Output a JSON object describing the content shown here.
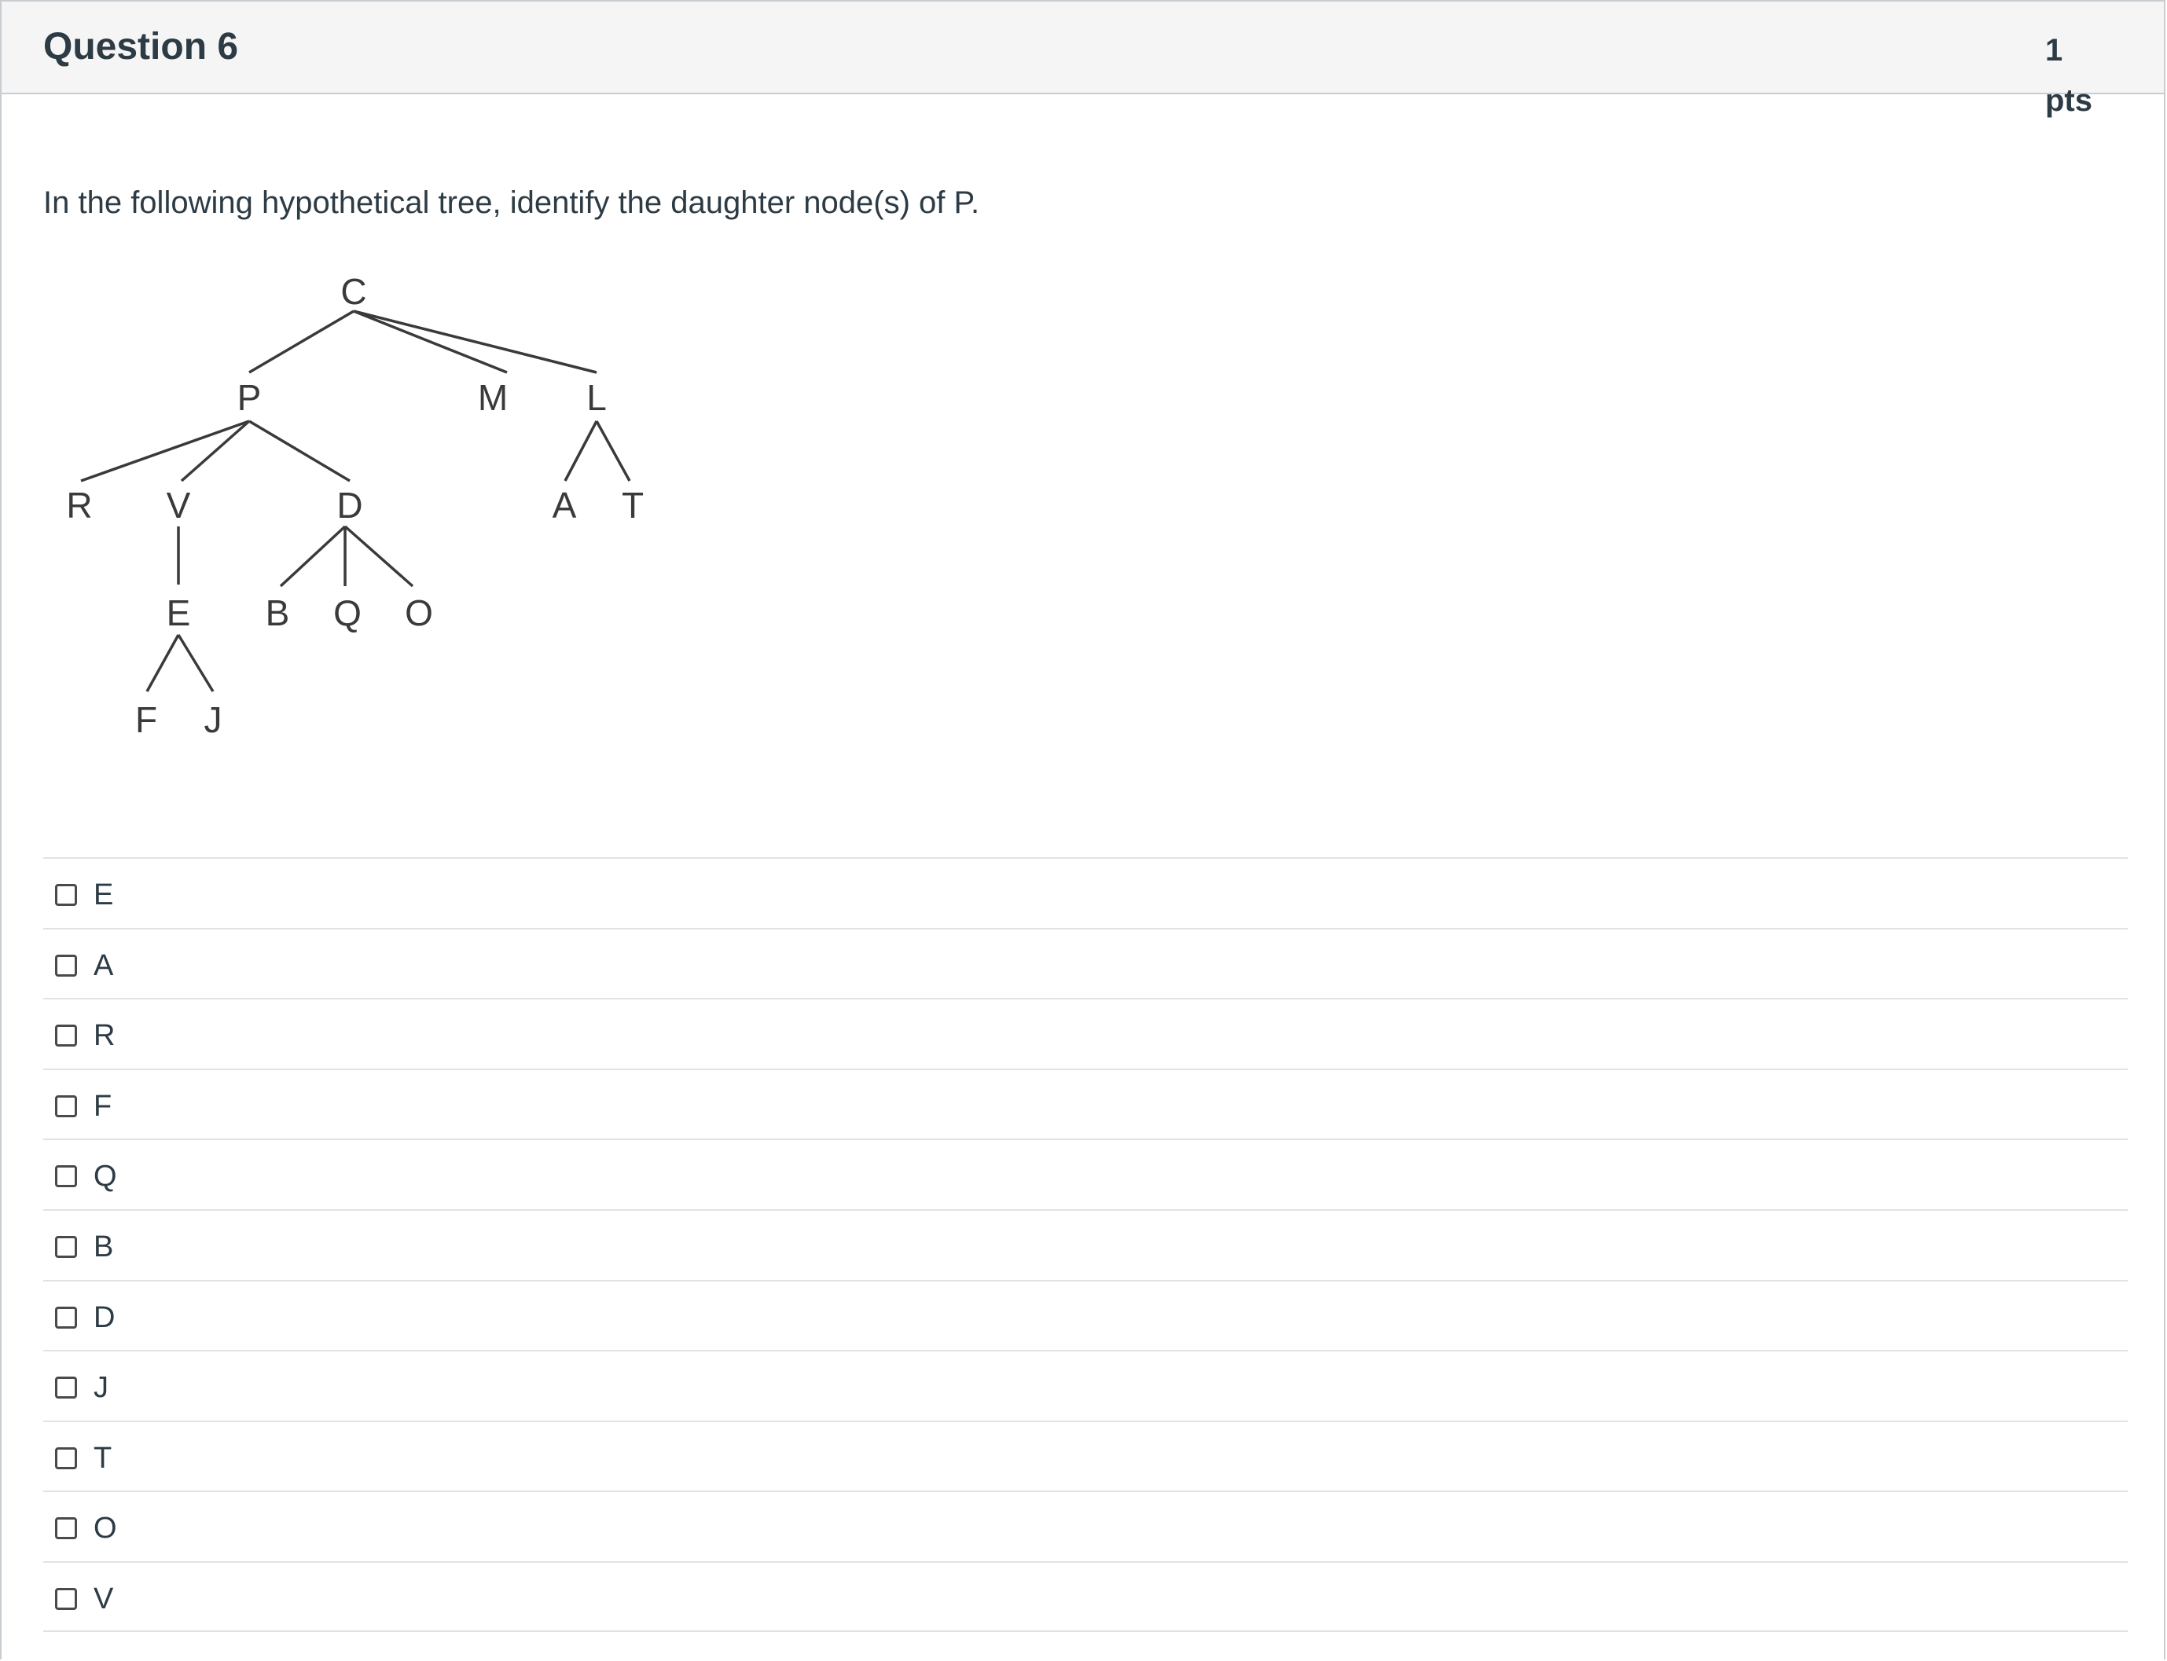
{
  "question": {
    "title": "Question 6",
    "points": "1 pts",
    "prompt": "In the following hypothetical tree, identify the daughter node(s) of P."
  },
  "tree": {
    "nodes": [
      "C",
      "P",
      "M",
      "L",
      "R",
      "V",
      "D",
      "A",
      "T",
      "E",
      "B",
      "Q",
      "O",
      "F",
      "J"
    ]
  },
  "answers": [
    {
      "label": "E",
      "checked": false
    },
    {
      "label": "A",
      "checked": false
    },
    {
      "label": "R",
      "checked": false
    },
    {
      "label": "F",
      "checked": false
    },
    {
      "label": "Q",
      "checked": false
    },
    {
      "label": "B",
      "checked": false
    },
    {
      "label": "D",
      "checked": false
    },
    {
      "label": "J",
      "checked": false
    },
    {
      "label": "T",
      "checked": false
    },
    {
      "label": "O",
      "checked": false
    },
    {
      "label": "V",
      "checked": false
    }
  ]
}
